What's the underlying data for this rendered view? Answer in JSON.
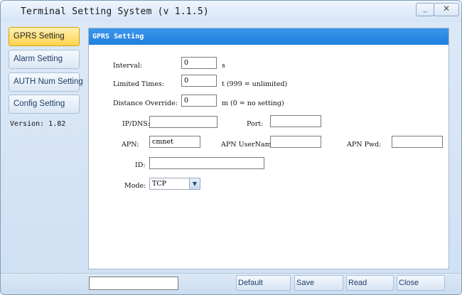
{
  "window": {
    "title": "Terminal Setting System (v 1.1.5)",
    "minimize_label": "_",
    "close_label": "✕"
  },
  "sidebar": {
    "items": [
      {
        "label": "GPRS Setting",
        "active": true
      },
      {
        "label": "Alarm Setting",
        "active": false
      },
      {
        "label": "AUTH Num Setting",
        "active": false
      },
      {
        "label": "Config Setting",
        "active": false
      }
    ],
    "version": "Version: 1.82"
  },
  "panel": {
    "title": "GPRS Setting",
    "fields": {
      "interval": {
        "label": "Interval:",
        "value": "0",
        "unit": "s"
      },
      "limited_times": {
        "label": "Limited Times:",
        "value": "0",
        "unit": "t (999 = unlimited)"
      },
      "distance_override": {
        "label": "Distance Override:",
        "value": "0",
        "unit": "m (0 = no setting)"
      },
      "ip_dns": {
        "label": "IP/DNS:",
        "value": ""
      },
      "port": {
        "label": "Port:",
        "value": ""
      },
      "apn": {
        "label": "APN:",
        "value": "cmnet"
      },
      "apn_username": {
        "label": "APN UserName:",
        "value": ""
      },
      "apn_pwd": {
        "label": "APN Pwd:",
        "value": ""
      },
      "id": {
        "label": "ID:",
        "value": ""
      },
      "mode": {
        "label": "Mode:",
        "value": "TCP"
      }
    }
  },
  "footer": {
    "status_value": "",
    "buttons": {
      "default": "Default",
      "save": "Save",
      "read": "Read",
      "close": "Close"
    }
  },
  "colors": {
    "header_blue": "#2a86e4",
    "active_yellow": "#ffd34d",
    "window_bg": "#d5e4f5"
  }
}
